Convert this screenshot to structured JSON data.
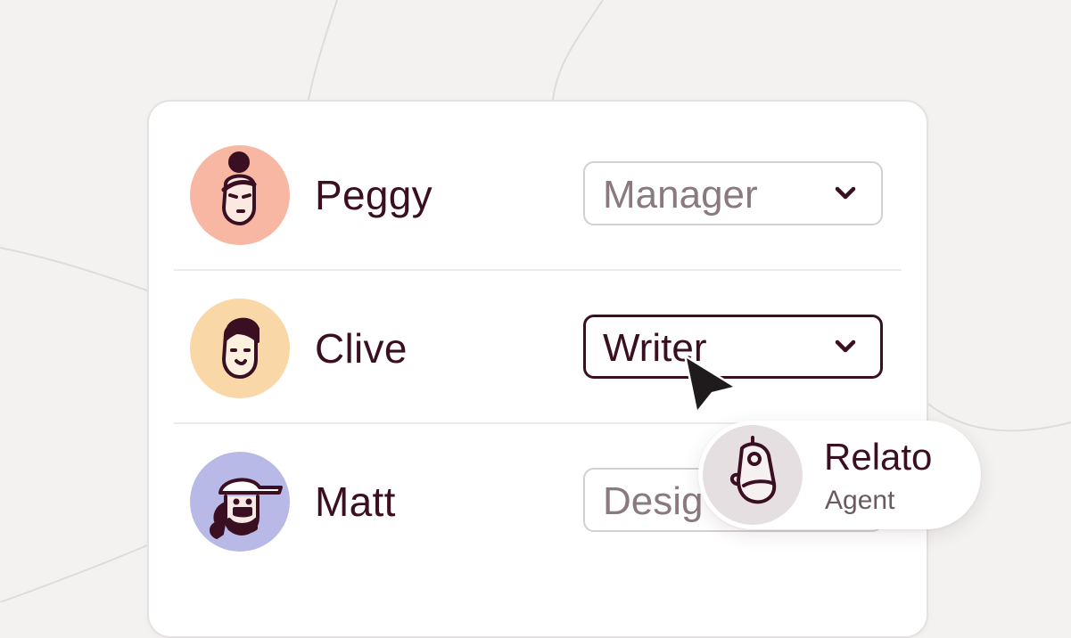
{
  "members": [
    {
      "name": "Peggy",
      "role": "Manager",
      "avatar_icon": "peggy-avatar-icon",
      "avatar_color": "#f8b7a3",
      "active": false
    },
    {
      "name": "Clive",
      "role": "Writer",
      "avatar_icon": "clive-avatar-icon",
      "avatar_color": "#fad7a6",
      "active": true
    },
    {
      "name": "Matt",
      "role": "Designer",
      "role_visible": "Desig",
      "avatar_icon": "matt-avatar-icon",
      "avatar_color": "#b8b9e6",
      "active": false
    }
  ],
  "agent": {
    "name": "Relato",
    "role": "Agent",
    "avatar_icon": "robot-avatar-icon",
    "avatar_color": "#e6dfe1"
  },
  "colors": {
    "text": "#3b0f22",
    "muted_text": "#8a7a80",
    "background": "#f3f2f1",
    "active_border": "#3b0f22",
    "inactive_border": "#d4d0cf"
  },
  "icons": {
    "chevron": "chevron-down-icon",
    "cursor": "mouse-pointer-icon"
  }
}
